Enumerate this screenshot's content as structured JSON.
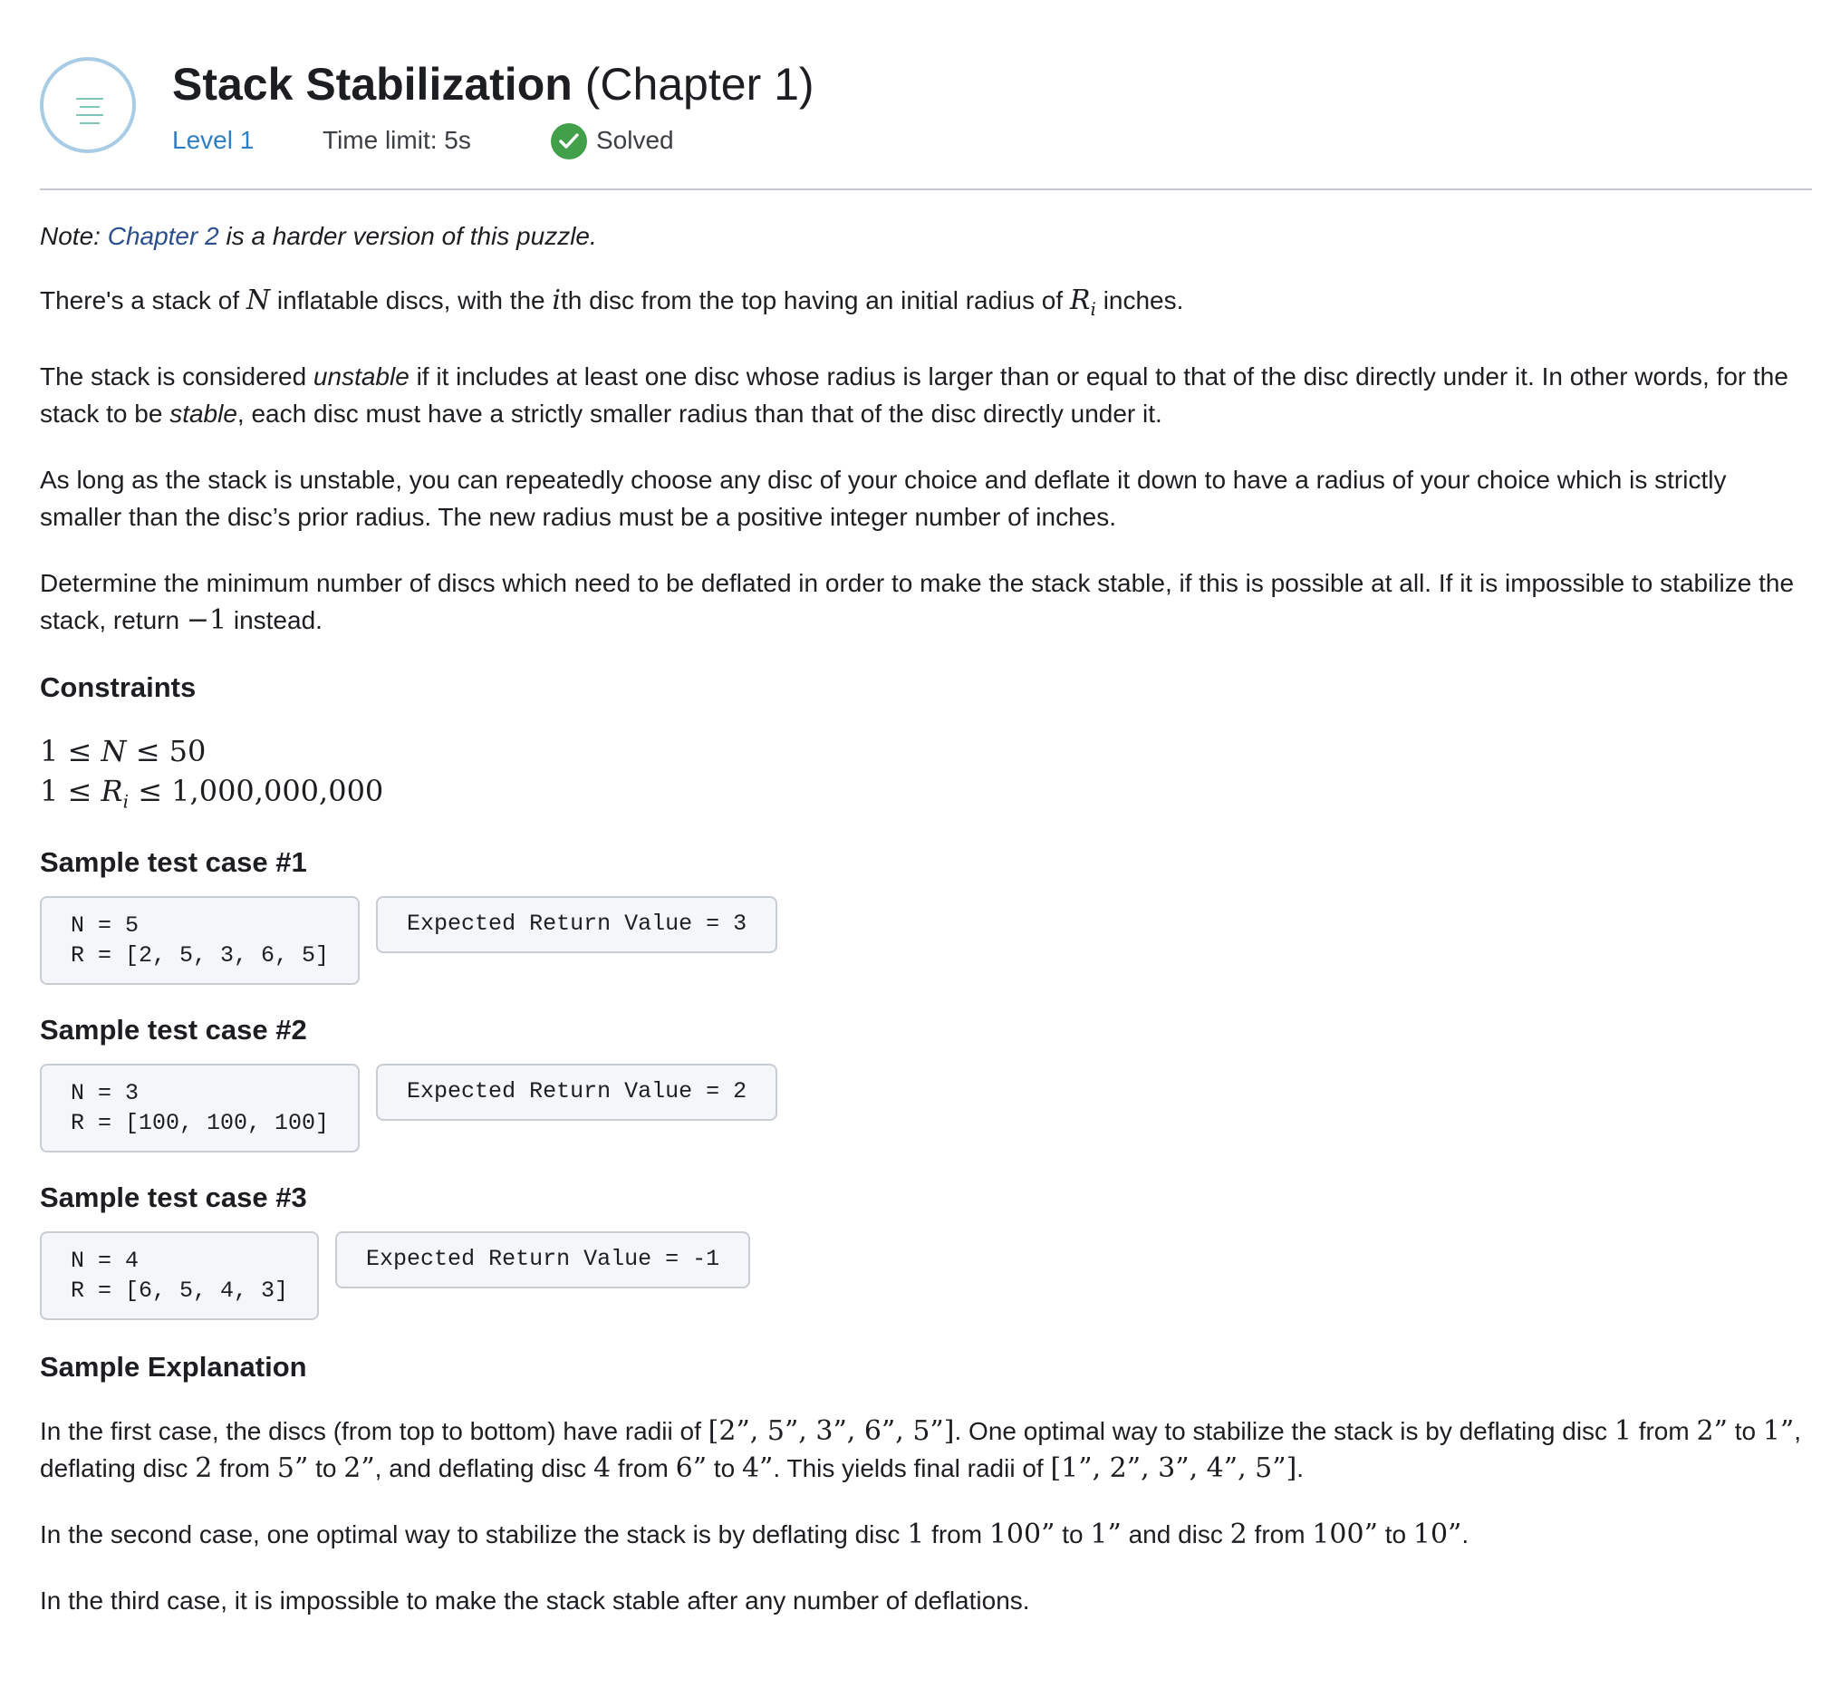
{
  "header": {
    "title_bold": "Stack Stabilization",
    "title_rest": "(Chapter 1)",
    "level": "Level 1",
    "time_limit": "Time limit: 5s",
    "status": "Solved",
    "logo_icon": "menu-lines-icon",
    "status_icon": "check-circle-icon"
  },
  "note": {
    "prefix": "Note:",
    "link": "Chapter 2",
    "suffix": "is a harder version of this puzzle."
  },
  "statement": {
    "p1": {
      "a": "There's a stack of",
      "N": "N",
      "b": "inflatable discs, with the",
      "i": "i",
      "c": "th disc from the top having an initial radius of",
      "R": "R",
      "sub": "i",
      "d": "inches."
    },
    "p2": {
      "a": "The stack is considered",
      "em1": "unstable",
      "b": "if it includes at least one disc whose radius is larger than or equal to that of the disc directly under it. In other words, for the stack to be",
      "em2": "stable",
      "c": ", each disc must have a strictly smaller radius than that of the disc directly under it."
    },
    "p3": "As long as the stack is unstable, you can repeatedly choose any disc of your choice and deflate it down to have a radius of your choice which is strictly smaller than the disc’s prior radius. The new radius must be a positive integer number of inches.",
    "p4": {
      "a": "Determine the minimum number of discs which need to be deflated in order to make the stack stable, if this is possible at all. If it is impossible to stabilize the stack, return",
      "val": "−1",
      "b": "instead."
    }
  },
  "constraints": {
    "heading": "Constraints",
    "line1": {
      "lo": "1 ≤ ",
      "var": "N",
      "hi": " ≤ 50"
    },
    "line2": {
      "lo": "1 ≤ ",
      "var": "R",
      "sub": "i",
      "hi": " ≤ 1,000,000,000"
    }
  },
  "samples": [
    {
      "heading": "Sample test case #1",
      "input": "N = 5\nR = [2, 5, 3, 6, 5]",
      "output": "Expected Return Value = 3"
    },
    {
      "heading": "Sample test case #2",
      "input": "N = 3\nR = [100, 100, 100]",
      "output": "Expected Return Value = 2"
    },
    {
      "heading": "Sample test case #3",
      "input": "N = 4\nR = [6, 5, 4, 3]",
      "output": "Expected Return Value = -1"
    }
  ],
  "explanation": {
    "heading": "Sample Explanation",
    "p1": {
      "a": "In the first case, the discs (from top to bottom) have radii of",
      "m1": "[2”, 5”, 3”, 6”, 5”]",
      "b": ". One optimal way to stabilize the stack is by deflating disc",
      "m2": "1",
      "c": "from",
      "m3": "2”",
      "d": "to",
      "m4": "1”",
      "e": ", deflating disc",
      "m5": "2",
      "f": "from",
      "m6": "5”",
      "g": "to",
      "m7": "2”",
      "h": ", and deflating disc",
      "m8": "4",
      "i": "from",
      "m9": "6”",
      "j": "to",
      "m10": "4”",
      "k": ". This yields final radii of",
      "m11": "[1”, 2”, 3”, 4”, 5”]",
      "l": "."
    },
    "p2": {
      "a": "In the second case, one optimal way to stabilize the stack is by deflating disc",
      "m1": "1",
      "b": "from",
      "m2": "100”",
      "c": "to",
      "m3": "1”",
      "d": "and disc",
      "m4": "2",
      "e": "from",
      "m5": "100”",
      "f": "to",
      "m6": "10”",
      "g": "."
    },
    "p3": "In the third case, it is impossible to make the stack stable after any number of deflations."
  }
}
